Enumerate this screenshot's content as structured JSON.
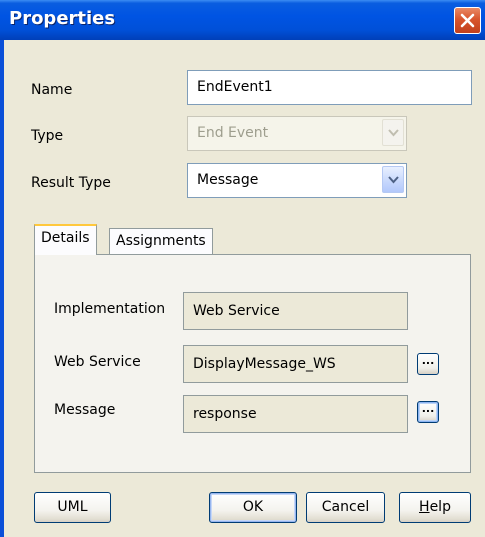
{
  "window": {
    "title": "Properties",
    "close_icon": "close-icon"
  },
  "form": {
    "name_label": "Name",
    "name_value": "EndEvent1",
    "type_label": "Type",
    "type_value": "End Event",
    "result_type_label": "Result Type",
    "result_type_value": "Message"
  },
  "tabs": [
    {
      "label": "Details",
      "active": true
    },
    {
      "label": "Assignments",
      "active": false
    }
  ],
  "details": {
    "implementation_label": "Implementation",
    "implementation_value": "Web Service",
    "web_service_label": "Web Service",
    "web_service_value": "DisplayMessage_WS",
    "message_label": "Message",
    "message_value": "response",
    "browse_label": "..."
  },
  "buttons": {
    "uml": "UML",
    "ok": "OK",
    "cancel": "Cancel",
    "help_first": "H",
    "help_rest": "elp"
  },
  "colors": {
    "titlebar": "#0054e3",
    "dialog_bg": "#ece9d8",
    "active_tab_highlight": "#ffc83c"
  }
}
